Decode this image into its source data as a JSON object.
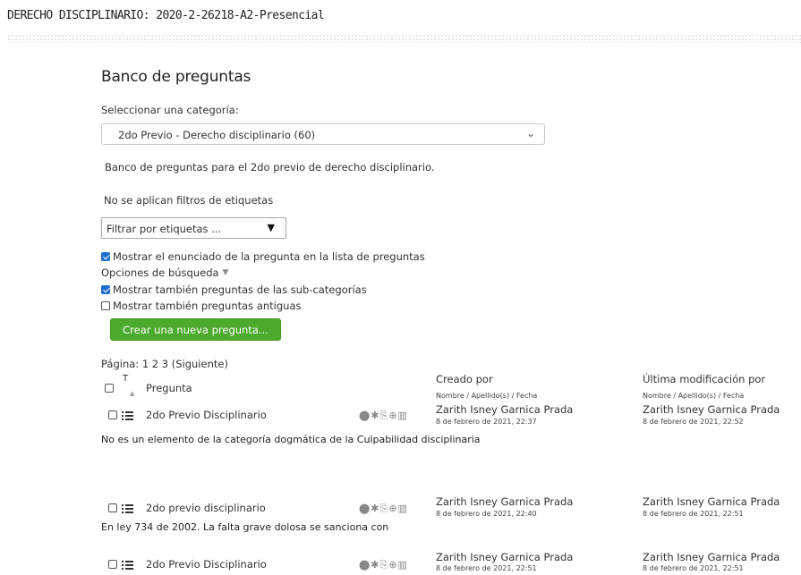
{
  "course_title": "DERECHO DISCIPLINARIO: 2020-2-26218-A2-Presencial",
  "heading": "Banco de preguntas",
  "category_label": "Seleccionar una categoría:",
  "category_selected": "2do Previo - Derecho disciplinario (60)",
  "category_info": "Banco de preguntas para el 2do previo de derecho disciplinario.",
  "no_tag_filters": "No se aplican filtros de etiquetas",
  "tag_filter_placeholder": "Filtrar por etiquetas ...",
  "options": {
    "show_question_text": {
      "label": "Mostrar el enunciado de la pregunta en la lista de preguntas",
      "checked": true
    },
    "search_options_label": "Opciones de búsqueda",
    "show_subcategories": {
      "label": "Mostrar también preguntas de las sub-categorías",
      "checked": true
    },
    "show_old": {
      "label": "Mostrar también preguntas antiguas",
      "checked": false
    }
  },
  "create_button": "Crear una nueva pregunta...",
  "pagination": "Página: 1 2 3 (Siguiente)",
  "table": {
    "sort_type": "T",
    "col_question": "Pregunta",
    "col_created": "Creado por",
    "col_created_sub": "Nombre / Apellido(s) / Fecha",
    "col_modified": "Última modificación por",
    "col_modified_sub": "Nombre / Apellido(s) / Fecha",
    "action_icons": "⬤✱⎘⊕▥",
    "rows": [
      {
        "name": "2do Previo Disciplinario",
        "created_by": "Zarith Isney Garnica Prada",
        "created_date": "8 de febrero de 2021, 22:37",
        "modified_by": "Zarith Isney Garnica Prada",
        "modified_date": "8 de febrero de 2021, 22:52",
        "text": "No es un elemento de la categoría dogmática de la Culpabilidad disciplinaria"
      },
      {
        "name": "2do previo disciplinario",
        "created_by": "Zarith Isney Garnica Prada",
        "created_date": "8 de febrero de 2021, 22:40",
        "modified_by": "Zarith Isney Garnica Prada",
        "modified_date": "8 de febrero de 2021, 22:51",
        "text": "En ley 734 de 2002. La falta grave dolosa se sanciona con"
      },
      {
        "name": "2do Previo Disciplinario",
        "created_by": "Zarith Isney Garnica Prada",
        "created_date": "8 de febrero de 2021, 22:51",
        "modified_by": "Zarith Isney Garnica Prada",
        "modified_date": "8 de febrero de 2021, 22:51",
        "text": ""
      }
    ]
  },
  "colors": {
    "accent_button": "#4caa2c",
    "checkbox": "#1d6fce"
  }
}
